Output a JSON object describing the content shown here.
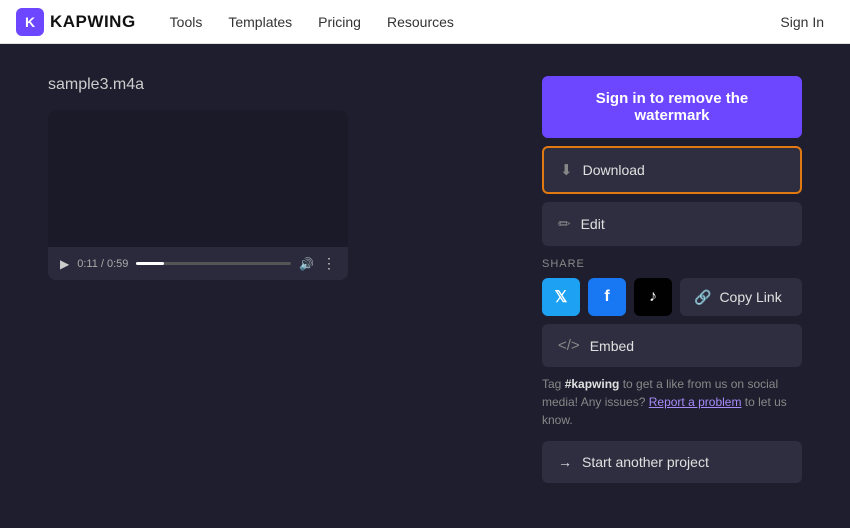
{
  "nav": {
    "logo_text": "KAPWING",
    "links": [
      "Tools",
      "Templates",
      "Pricing",
      "Resources"
    ],
    "signin": "Sign In"
  },
  "main": {
    "file_title": "sample3.m4a",
    "video": {
      "current_time": "0:11",
      "total_time": "0:59"
    }
  },
  "actions": {
    "watermark_btn": "Sign in to remove the watermark",
    "download_btn": "Download",
    "edit_btn": "Edit",
    "share_label": "SHARE",
    "copy_link_btn": "Copy Link",
    "embed_btn": "Embed",
    "new_project_btn": "Start another project"
  },
  "tag": {
    "prefix": "Tag ",
    "hashtag": "#kapwing",
    "middle": " to get a like from us on social media! Any issues? ",
    "link": "Report a problem",
    "suffix": " to let us know."
  },
  "icons": {
    "download": "⬇",
    "edit": "✏",
    "copylink": "🔗",
    "embed": "</>",
    "arrow": "→",
    "play": "▶",
    "volume": "🔊",
    "more": "⋮",
    "twitter": "𝕏",
    "facebook": "f",
    "tiktok": "♪"
  }
}
